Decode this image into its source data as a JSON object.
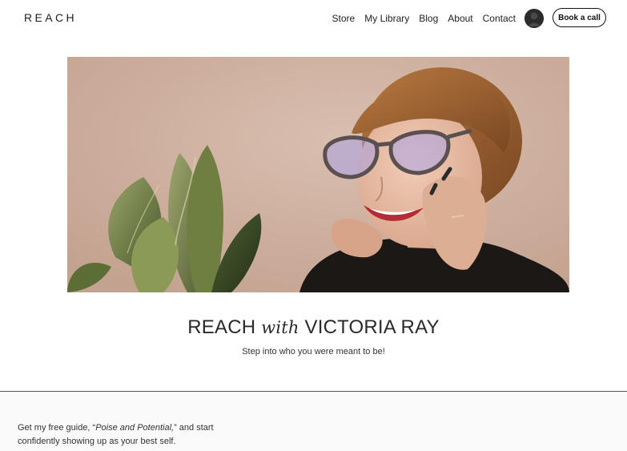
{
  "header": {
    "logo": "REACH",
    "nav": [
      "Store",
      "My Library",
      "Blog",
      "About",
      "Contact"
    ],
    "book_button": "Book a call"
  },
  "hero": {
    "title_part1": "REACH ",
    "title_italic": "with",
    "title_part2": " VICTORIA RAY",
    "subtitle": "Step into who you were meant to be!"
  },
  "guide": {
    "text_before": "Get my free guide, “",
    "text_italic": "Poise and Potential,",
    "text_after": "” and start confidently showing up as your best self."
  },
  "colors": {
    "hero_background": "#d4b7a6",
    "text": "#222222",
    "divider": "#555555"
  }
}
